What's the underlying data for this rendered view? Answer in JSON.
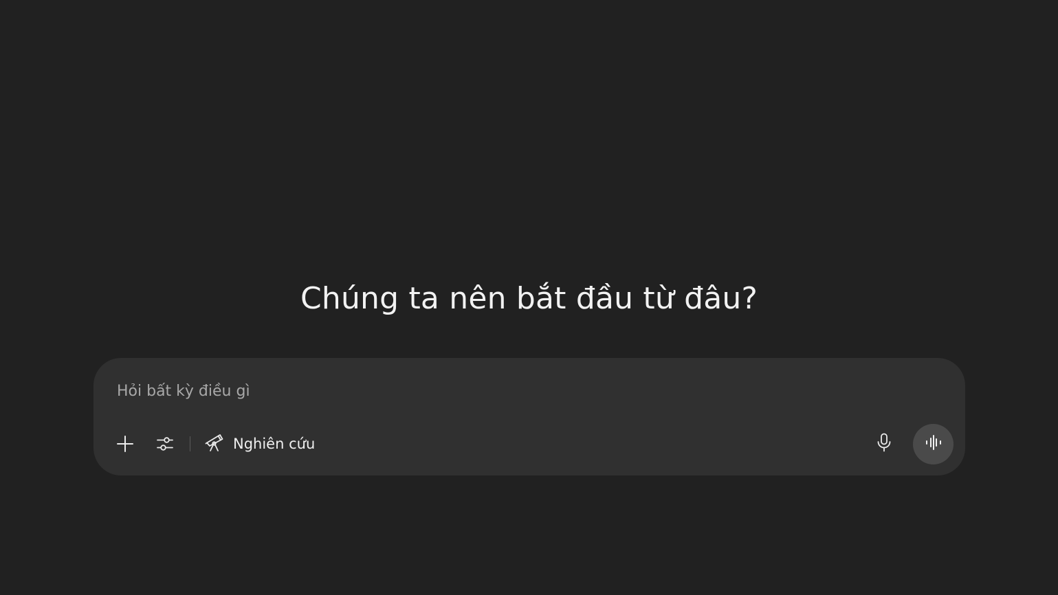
{
  "headline": "Chúng ta nên bắt đầu từ đâu?",
  "composer": {
    "placeholder": "Hỏi bất kỳ điều gì",
    "value": "",
    "tools": {
      "add_icon": "plus-icon",
      "settings_icon": "sliders-icon",
      "research_icon": "telescope-icon",
      "research_label": "Nghiên cứu"
    },
    "actions": {
      "mic_icon": "microphone-icon",
      "voice_icon": "voice-waveform-icon"
    }
  },
  "colors": {
    "background": "#212121",
    "composer": "#303030",
    "voice_button": "#4a4a4a",
    "text": "#ececec",
    "placeholder": "#a8a8a8"
  }
}
